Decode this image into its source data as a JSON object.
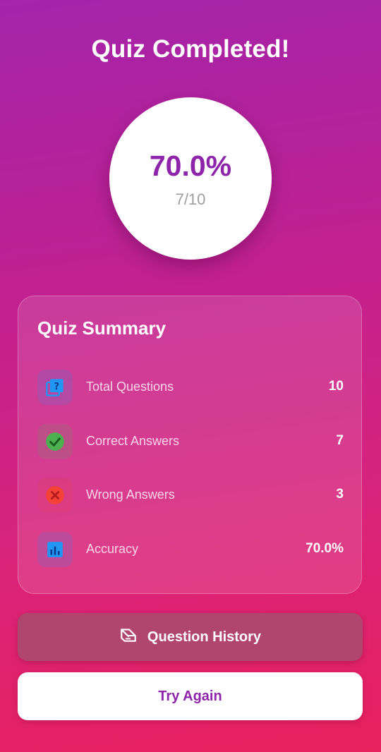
{
  "header": {
    "title": "Quiz Completed!"
  },
  "score": {
    "percent": "70.0%",
    "fraction": "7/10"
  },
  "summary": {
    "title": "Quiz Summary",
    "rows": [
      {
        "label": "Total Questions",
        "value": "10",
        "icon": "quiz-icon",
        "color": "#2196f3"
      },
      {
        "label": "Correct Answers",
        "value": "7",
        "icon": "check-circle-icon",
        "color": "#4caf50"
      },
      {
        "label": "Wrong Answers",
        "value": "3",
        "icon": "cancel-circle-icon",
        "color": "#f44336"
      },
      {
        "label": "Accuracy",
        "value": "70.0%",
        "icon": "bar-chart-icon",
        "color": "#2196f3"
      }
    ]
  },
  "actions": {
    "history_label": "Question History",
    "history_icon": "history-icon",
    "try_again_label": "Try Again"
  },
  "colors": {
    "accent": "#8e24aa",
    "gradient_top": "#a324aa",
    "gradient_bottom": "#e8205e"
  }
}
